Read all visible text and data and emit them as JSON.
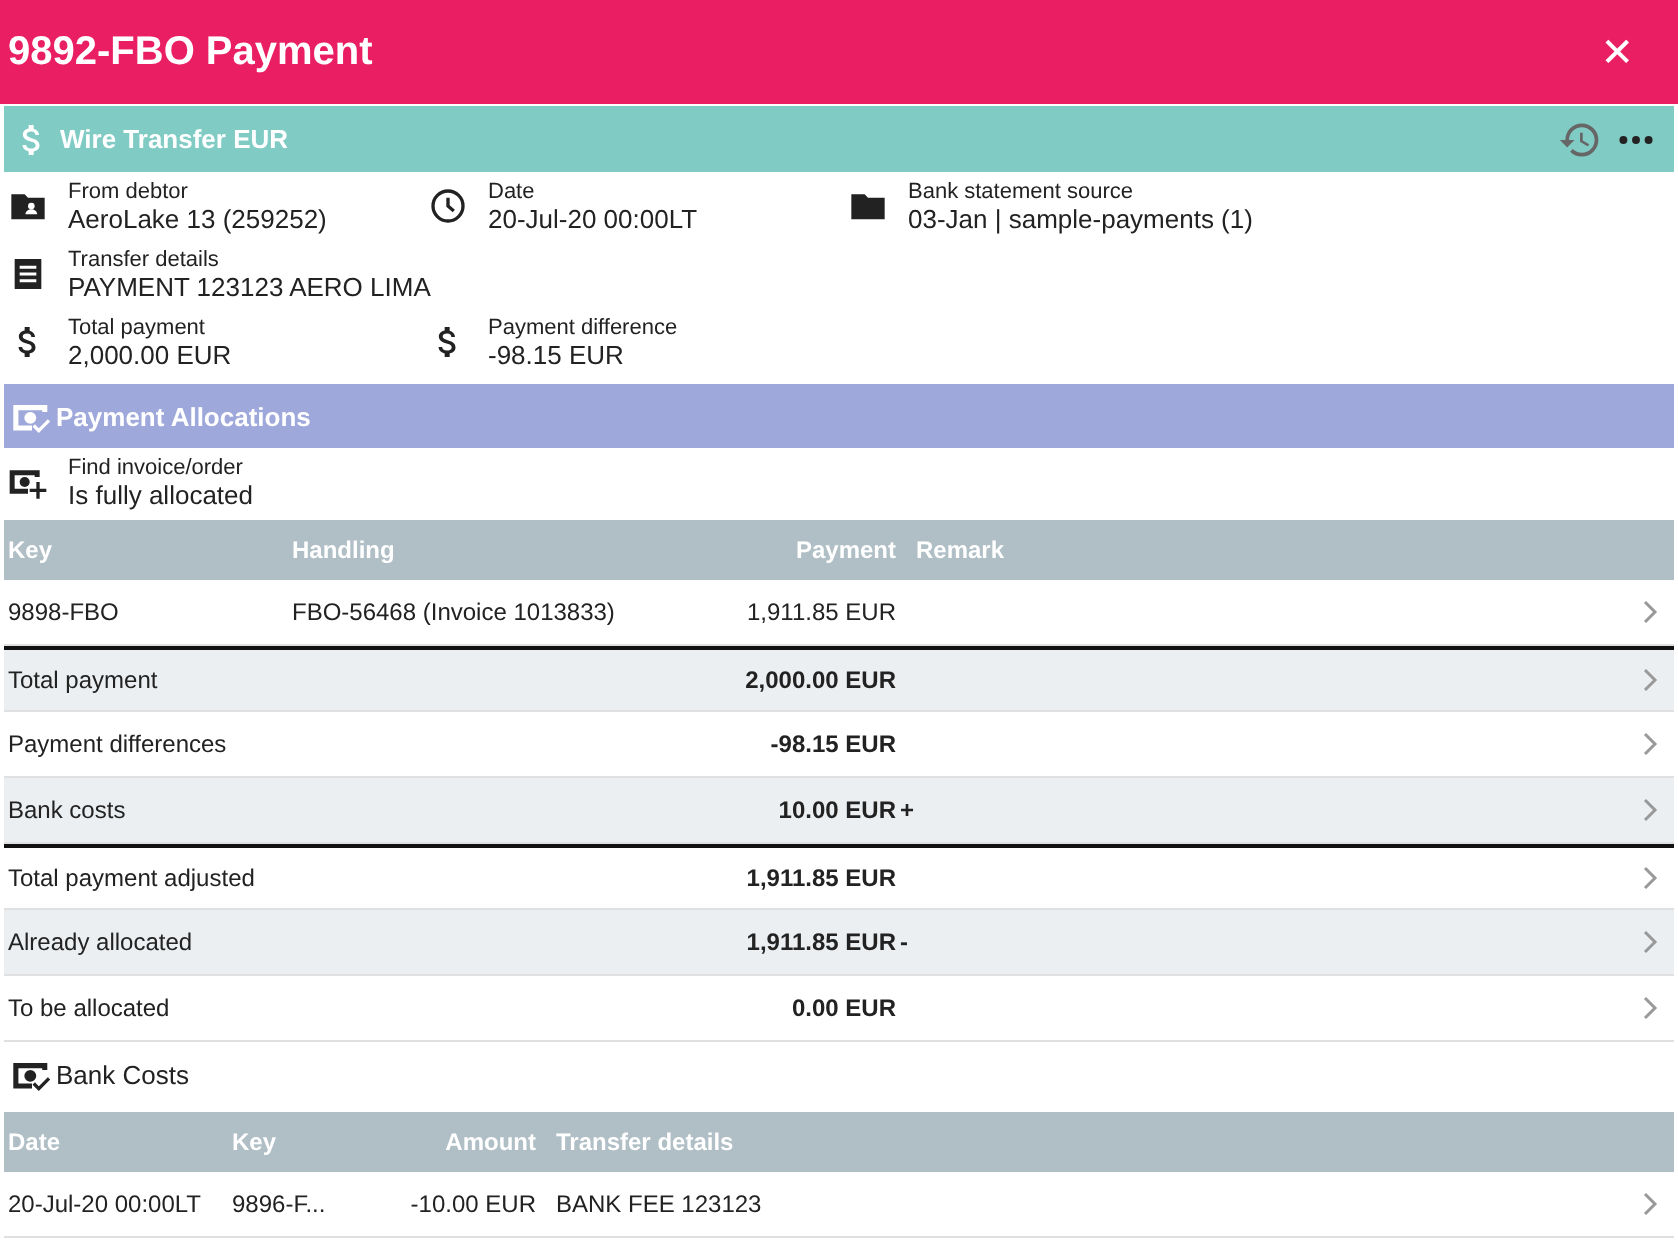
{
  "window": {
    "title": "9892-FBO Payment",
    "close": "✕"
  },
  "transfer": {
    "title": "Wire Transfer EUR"
  },
  "fields": [
    {
      "kind": "debtor",
      "label": "From debtor",
      "value": "AeroLake 13 (259252)"
    },
    {
      "kind": "date",
      "label": "Date",
      "value": "20-Jul-20 00:00LT"
    },
    {
      "kind": "folder",
      "label": "Bank statement source",
      "value": "03-Jan | sample-payments (1)"
    },
    {
      "kind": "details",
      "label": "Transfer details",
      "value": "PAYMENT 123123 AERO LIMA"
    },
    {
      "kind": "blank"
    },
    {
      "kind": "blank"
    },
    {
      "kind": "dollar",
      "label": "Total payment",
      "value": "2,000.00 EUR"
    },
    {
      "kind": "dollar",
      "label": "Payment difference",
      "value": "-98.15 EUR"
    }
  ],
  "allocations": {
    "title": "Payment Allocations",
    "find_label": "Find invoice/order",
    "find_value": "Is fully allocated",
    "columns": [
      "Key",
      "Handling",
      "Payment",
      "Remark"
    ],
    "rows": [
      {
        "key": "9898-FBO",
        "handling": "FBO-56468 (Invoice 1013833)",
        "payment": "1,911.85 EUR"
      }
    ]
  },
  "summary": [
    {
      "label": "Total payment",
      "amount": "2,000.00 EUR",
      "divider_above": true
    },
    {
      "label": "Payment differences",
      "amount": "-98.15 EUR",
      "divider_above": false
    },
    {
      "label": "Bank costs",
      "amount": "10.00 EUR",
      "sign": "+",
      "divider_above": false
    },
    {
      "label": "Total payment adjusted",
      "amount": "1,911.85 EUR",
      "divider_above": true
    },
    {
      "label": "Already allocated",
      "amount": "1,911.85 EUR",
      "sign": "-",
      "divider_above": false
    },
    {
      "label": "To be allocated",
      "amount": "0.00 EUR",
      "divider_above": false
    }
  ],
  "bank_costs": {
    "title": "Bank Costs",
    "columns": [
      "Date",
      "Key",
      "Amount",
      "Transfer details"
    ],
    "rows": [
      {
        "date": "20-Jul-20 00:00LT",
        "key": "9896-F...",
        "amount": "-10.00 EUR",
        "details": "BANK FEE 123123"
      }
    ]
  }
}
